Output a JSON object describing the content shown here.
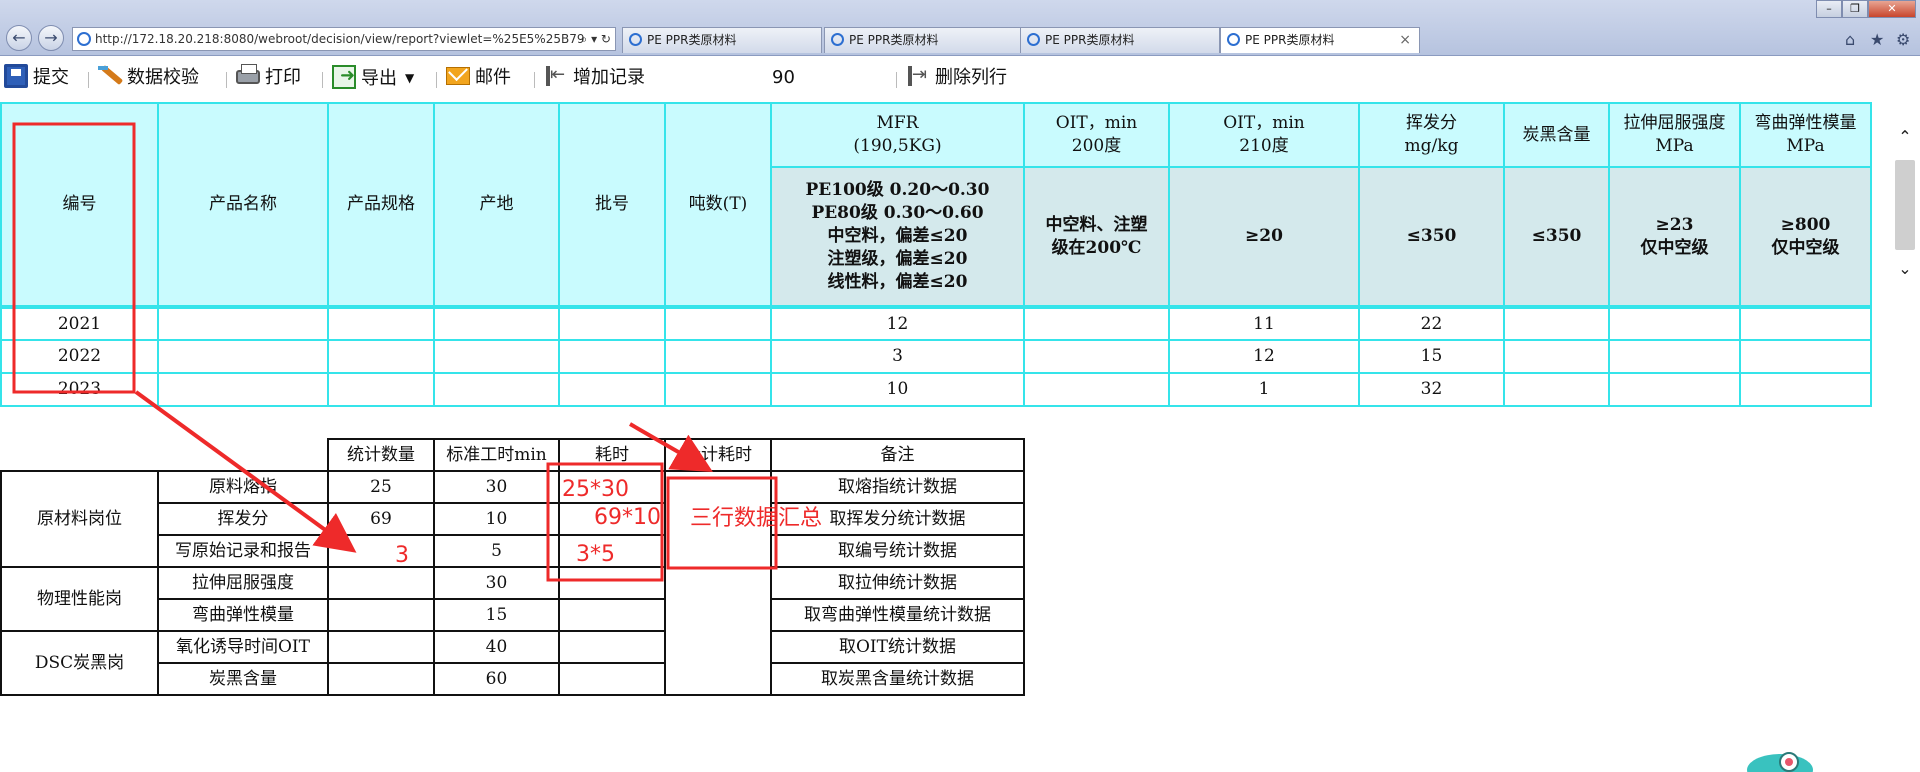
{
  "browser": {
    "address": "http://172.18.20.218:8080/webroot/decision/view/report?viewlet=%25E5%25B79",
    "tabs": [
      {
        "label": "PE PPR类原材料",
        "active": false
      },
      {
        "label": "PE PPR类原材料",
        "active": false
      },
      {
        "label": "PE PPR类原材料",
        "active": false
      },
      {
        "label": "PE PPR类原材料",
        "active": true
      }
    ]
  },
  "toolbar": {
    "submit": "提交",
    "validate": "数据校验",
    "print": "打印",
    "export": "导出",
    "email": "邮件",
    "add_record": "增加记录",
    "count_value": "90",
    "delete_column": "删除列行"
  },
  "report": {
    "headers": {
      "id": "编号",
      "product_name": "产品名称",
      "spec": "产品规格",
      "origin": "产地",
      "batch": "批号",
      "tonnage": "吨数(T)",
      "mfr": "MFR\n(190,5KG)",
      "oit200": "OIT，min\n200度",
      "oit210": "OIT，min\n210度",
      "volatile": "挥发分\nmg/kg",
      "carbon": "炭黑含量",
      "tensile": "拉伸屈服强度\nMPa",
      "flexural": "弯曲弹性模量\nMPa"
    },
    "standards": {
      "mfr": "PE100级 0.20～0.30\nPE80级 0.30～0.60\n中空料，偏差≤20\n注塑级，偏差≤20\n线性料，偏差≤20",
      "oit200": "中空料、注塑\n级在200℃",
      "oit210": "≥20",
      "volatile": "≤350",
      "carbon": "≤350",
      "tensile": "≥23\n仅中空级",
      "flexural": "≥800\n仅中空级"
    },
    "rows": [
      {
        "id": "2021",
        "mfr": "12",
        "oit210": "11",
        "volatile": "22"
      },
      {
        "id": "2022",
        "mfr": "3",
        "oit210": "12",
        "volatile": "15"
      },
      {
        "id": "2023",
        "mfr": "10",
        "oit210": "1",
        "volatile": "32"
      }
    ]
  },
  "stats": {
    "headers": {
      "count": "统计数量",
      "std_time": "标准工时min",
      "time": "耗时",
      "total_time": "合计耗时",
      "remark": "备注"
    },
    "groups": [
      {
        "name": "原材料岗位",
        "items": [
          {
            "item": "原料熔指",
            "count": "25",
            "std": "30",
            "remark": "取熔指统计数据"
          },
          {
            "item": "挥发分",
            "count": "69",
            "std": "10",
            "remark": "取挥发分统计数据"
          },
          {
            "item": "写原始记录和报告",
            "count": "",
            "std": "5",
            "remark": "取编号统计数据"
          }
        ]
      },
      {
        "name": "物理性能岗",
        "items": [
          {
            "item": "拉伸屈服强度",
            "count": "",
            "std": "30",
            "remark": "取拉伸统计数据"
          },
          {
            "item": "弯曲弹性模量",
            "count": "",
            "std": "15",
            "remark": "取弯曲弹性模量统计数据"
          }
        ]
      },
      {
        "name": "DSC炭黑岗",
        "items": [
          {
            "item": "氧化诱导时间OIT",
            "count": "",
            "std": "40",
            "remark": "取OIT统计数据"
          },
          {
            "item": "炭黑含量",
            "count": "",
            "std": "60",
            "remark": "取炭黑含量统计数据"
          }
        ]
      }
    ]
  },
  "annotations": {
    "count_three": "3",
    "calc1": "25*30",
    "calc2": "69*10",
    "calc3": "3*5",
    "summary": "三行数据汇总",
    "color": "#ee2a2a"
  },
  "colors": {
    "grid_border": "#35e4ea",
    "header_bg": "#c9fbfe",
    "standard_bg": "#d4e9ec"
  }
}
